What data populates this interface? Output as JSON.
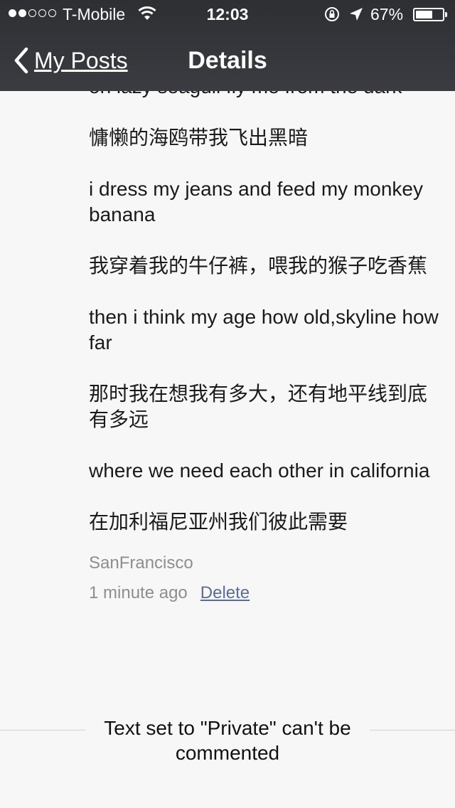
{
  "status_bar": {
    "signal_filled": 2,
    "signal_total": 5,
    "carrier": "T-Mobile",
    "time": "12:03",
    "battery_text": "67%",
    "battery_level": 0.67
  },
  "nav": {
    "back_label": "My Posts",
    "title": "Details"
  },
  "post": {
    "paragraphs": [
      "on lazy seagull fly me from the dark",
      "慵懒的海鸥带我飞出黑暗",
      "i dress my jeans and feed my monkey banana",
      "我穿着我的牛仔裤，喂我的猴子吃香蕉",
      "then i think my age how old,skyline how far",
      "那时我在想我有多大，还有地平线到底有多远",
      "where we need each other in california",
      "在加利福尼亚州我们彼此需要"
    ],
    "location": "SanFrancisco",
    "time_ago": "1 minute ago",
    "delete_label": "Delete"
  },
  "comments": {
    "private_notice": "Text set to \"Private\" can't be commented"
  }
}
